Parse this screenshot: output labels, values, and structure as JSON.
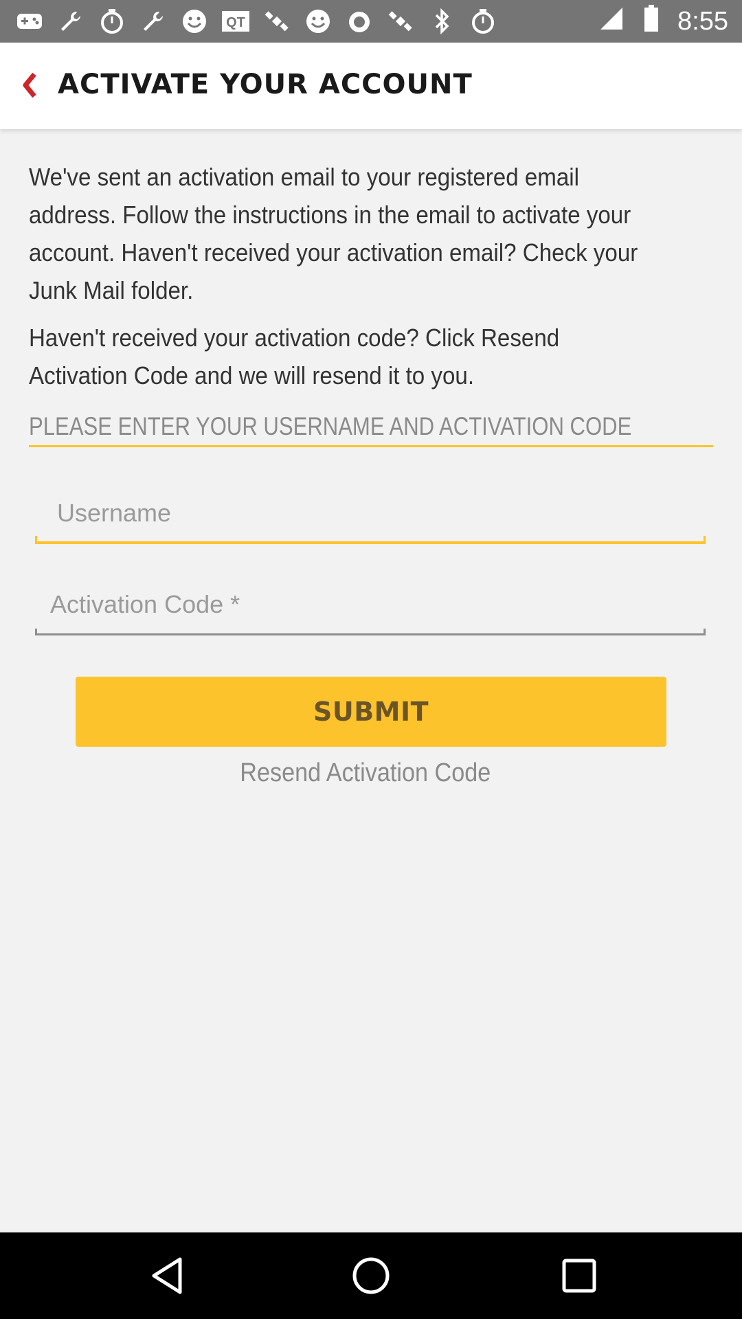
{
  "status_bar": {
    "time": "8:55",
    "left_icons": [
      "gamepad-icon",
      "wrench-icon",
      "stopwatch-icon",
      "wrench-icon",
      "smiley-icon",
      "qt-icon",
      "satellite-icon",
      "smiley-icon",
      "stopwatch-icon",
      "satellite-icon",
      "bluetooth-icon",
      "stopwatch-icon",
      "signal-icon"
    ],
    "qt_label": "QT"
  },
  "header": {
    "title": "ACTIVATE YOUR ACCOUNT",
    "accent_color": "#d0242b"
  },
  "main": {
    "paragraph_1": "We've sent an activation email to your registered email address. Follow the instructions in the email to activate your account. Haven't received your activation email? Check your Junk Mail folder.",
    "paragraph_2": "Haven't received your activation code? Click Resend Activation Code and we will resend it to you.",
    "section_header": "PLEASE ENTER YOUR USERNAME AND ACTIVATION CODE",
    "username_field": {
      "placeholder": "Username",
      "value": ""
    },
    "activation_code_field": {
      "placeholder": "Activation Code *",
      "value": ""
    },
    "submit_label": "SUBMIT",
    "resend_label": "Resend Activation Code",
    "brand_color": "#fcc32c"
  },
  "nav_bar": {
    "buttons": [
      "back-triangle",
      "home-circle",
      "recents-square"
    ]
  }
}
